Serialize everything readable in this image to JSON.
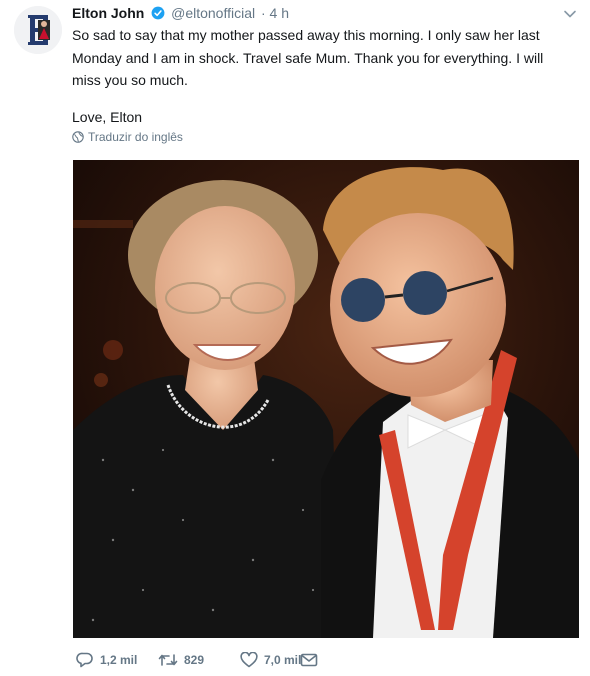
{
  "tweet": {
    "author_name": "Elton John",
    "handle": "@eltonofficial",
    "time": "· 4 h",
    "lines": [
      "So sad to say that my mother passed away this morning. I only saw her last",
      "Monday and I am in shock. Travel safe Mum. Thank you for everything. I will",
      "miss you so much."
    ],
    "signoff": "Love, Elton",
    "translate_label": "Traduzir do inglês"
  },
  "actions": {
    "replies": "1,2 mil",
    "retweets": "829",
    "likes": "7,0 mil"
  },
  "icons": {
    "verified": "verified-badge-icon",
    "menu": "chevron-down-icon",
    "translate": "globe-icon",
    "reply": "reply-icon",
    "retweet": "retweet-icon",
    "like": "heart-icon",
    "message": "envelope-icon"
  },
  "colors": {
    "verified_blue": "#1da1f2",
    "muted_text": "#657786",
    "text": "#14171a"
  }
}
